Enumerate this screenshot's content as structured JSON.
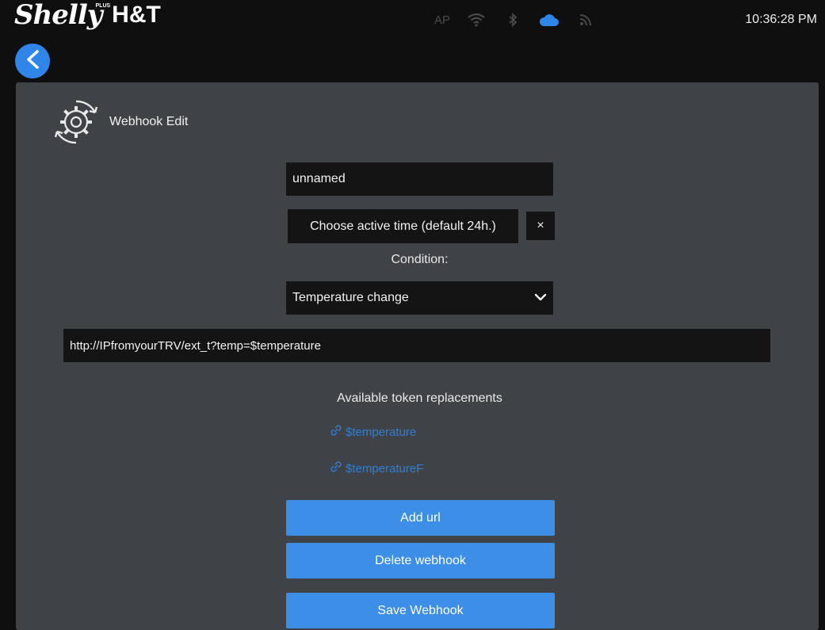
{
  "header": {
    "logo_script": "Shelly",
    "logo_plus": "PLUS",
    "logo_model": "H&T",
    "status_ap": "AP",
    "clock": "10:36:28 PM"
  },
  "icons": {
    "wifi": "wifi-icon",
    "bluetooth": "bluetooth-icon",
    "cloud": "cloud-icon",
    "rss": "rss-icon",
    "back": "back-arrow-icon",
    "gear": "gear-icon",
    "link": "link-icon",
    "chevron": "chevron-down-icon",
    "close": "close-icon"
  },
  "colors": {
    "accent": "#3c8ee6",
    "cloud_active": "#2f86e8",
    "panel": "#3f4246",
    "field": "#141414"
  },
  "page": {
    "title": "Webhook Edit",
    "name_value": "unnamed",
    "active_time_label": "Choose active time (default 24h.)",
    "clear_label": "×",
    "condition_label": "Condition:",
    "condition_selected": "Temperature change",
    "url_value": "http://IPfromyourTRV/ext_t?temp=$temperature",
    "tokens_label": "Available token replacements",
    "tokens": [
      "$temperature",
      "$temperatureF"
    ],
    "add_url": "Add url",
    "delete_webhook": "Delete webhook",
    "save_webhook": "Save Webhook"
  }
}
